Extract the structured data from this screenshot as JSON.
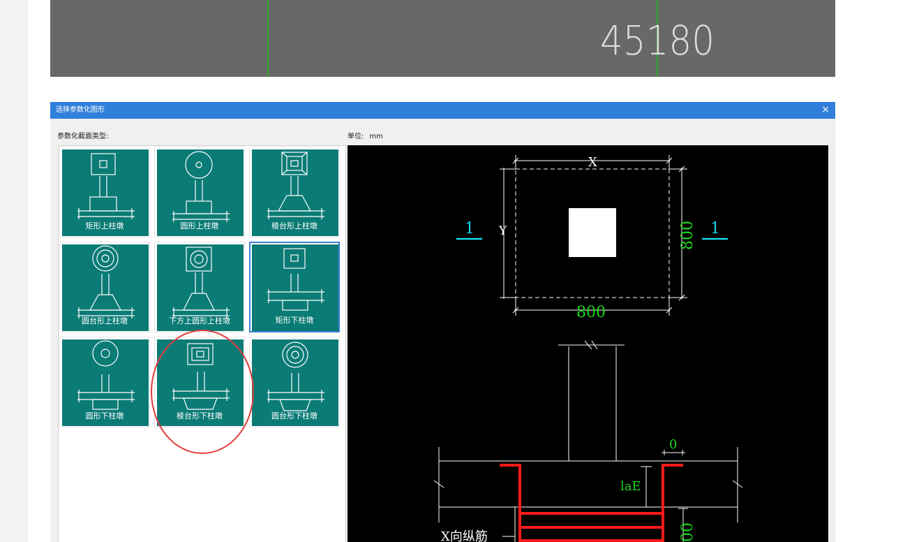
{
  "cad_strip": {
    "number": "45180",
    "colors": {
      "background": "#686868",
      "line": "#17c017",
      "text": "#dcdcdc"
    }
  },
  "dialog": {
    "title": "选择参数化图形",
    "close_glyph": "×",
    "types_label": "参数化截面类型:",
    "unit_label": "单位:",
    "unit_value": "mm",
    "colors": {
      "titlebar": "#2f7fdb",
      "tile": "#0b7b76",
      "selected_border": "#3a7fd6"
    },
    "tiles": [
      {
        "label": "矩形上柱墩",
        "icon": "rect-upper-pier-icon"
      },
      {
        "label": "圆形上柱墩",
        "icon": "circle-upper-pier-icon"
      },
      {
        "label": "棱台形上柱墩",
        "icon": "frustum-upper-pier-icon"
      },
      {
        "label": "圆台形上柱墩",
        "icon": "round-frustum-upper-pier-icon"
      },
      {
        "label": "下方上圆形上柱墩",
        "icon": "square-round-upper-pier-icon"
      },
      {
        "label": "矩形下柱墩",
        "icon": "rect-lower-pier-icon",
        "selected": true
      },
      {
        "label": "圆形下柱墩",
        "icon": "circle-lower-pier-icon"
      },
      {
        "label": "棱台形下柱墩",
        "icon": "frustum-lower-pier-icon"
      },
      {
        "label": "圆台形下柱墩",
        "icon": "round-frustum-lower-pier-icon"
      }
    ]
  },
  "preview": {
    "dim_x": "X",
    "dim_y": "Y",
    "dim_800_bottom": "800",
    "dim_800_right": "800",
    "section_left": "1",
    "section_right": "1",
    "dim_zero": "0",
    "label_lae": "laE",
    "label_x_rebar": "X向纵筋",
    "dim_00": "00",
    "colors": {
      "white": "#ffffff",
      "green": "#1ed81e",
      "cyan": "#18d8e8",
      "red": "#ff1a1a"
    }
  },
  "annotation": {
    "color": "#e23c3c"
  }
}
